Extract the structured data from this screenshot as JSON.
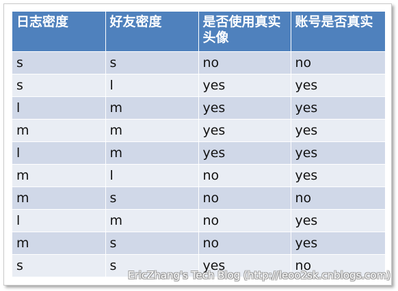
{
  "table": {
    "headers": [
      "日志密度",
      "好友密度",
      "是否使用真实头像",
      "账号是否真实"
    ],
    "rows": [
      [
        "s",
        "s",
        "no",
        "no"
      ],
      [
        "s",
        "l",
        "yes",
        "yes"
      ],
      [
        "l",
        "m",
        "yes",
        "yes"
      ],
      [
        "m",
        "m",
        "yes",
        "yes"
      ],
      [
        "l",
        "m",
        "yes",
        "yes"
      ],
      [
        "m",
        "l",
        "no",
        "yes"
      ],
      [
        "m",
        "s",
        "no",
        "no"
      ],
      [
        "l",
        "m",
        "no",
        "yes"
      ],
      [
        "m",
        "s",
        "no",
        "yes"
      ],
      [
        "s",
        "s",
        "yes",
        "no"
      ]
    ]
  },
  "watermark": "EricZhang's Tech Blog (http://leoo2sk.cnblogs.com)",
  "colors": {
    "header_bg": "#4f81bd",
    "row_odd_bg": "#d0d8e8",
    "row_even_bg": "#e9edf4"
  }
}
